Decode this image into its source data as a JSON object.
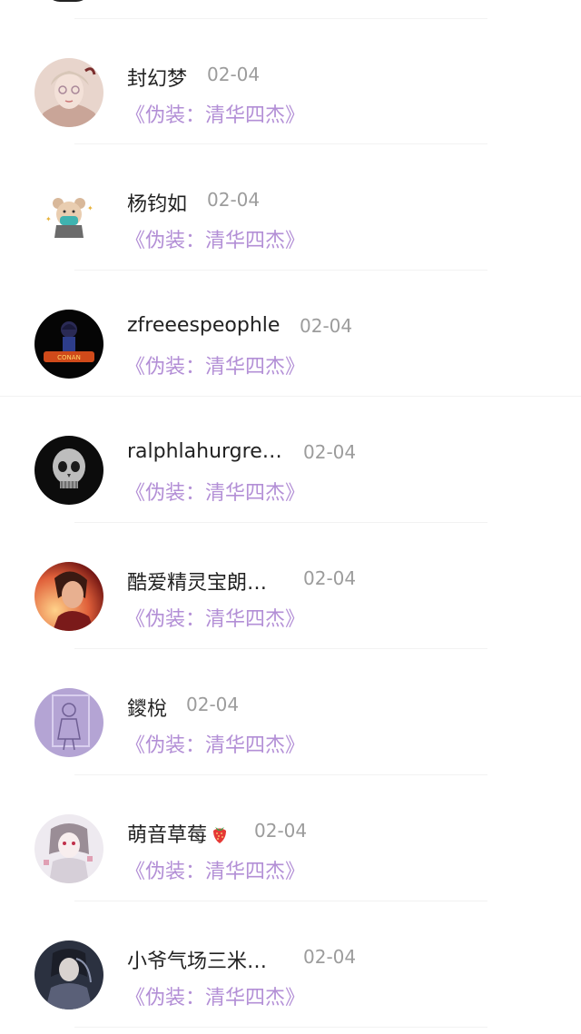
{
  "items": [
    {
      "name": "封幻梦",
      "date": "02-04",
      "subtitle": "《伪装：清华四杰》",
      "avatar_icon": "girl-portrait-avatar"
    },
    {
      "name": "杨钧如",
      "date": "02-04",
      "subtitle": "《伪装：清华四杰》",
      "avatar_icon": "bear-mask-avatar"
    },
    {
      "name": "zfreeespeophle",
      "date": "02-04",
      "subtitle": "《伪装：清华四杰》",
      "avatar_icon": "detective-logo-avatar"
    },
    {
      "name": "ralphlahurgre…",
      "date": "02-04",
      "subtitle": "《伪装：清华四杰》",
      "avatar_icon": "skull-avatar"
    },
    {
      "name": "酷爱精灵宝朗…",
      "date": "02-04",
      "subtitle": "《伪装：清华四杰》",
      "avatar_icon": "game-character-avatar"
    },
    {
      "name": "鑁梲",
      "date": "02-04",
      "subtitle": "《伪装：清华四杰》",
      "avatar_icon": "purple-sketch-avatar"
    },
    {
      "name": "萌音草莓",
      "date": "02-04",
      "subtitle": "《伪装：清华四杰》",
      "avatar_icon": "anime-girl-avatar",
      "name_emoji": "strawberry-icon"
    },
    {
      "name": "小爷气场三米…",
      "date": "02-04",
      "subtitle": "《伪装：清华四杰》",
      "avatar_icon": "dark-anime-avatar"
    }
  ],
  "colors": {
    "name": "#222222",
    "date": "#9c9c9c",
    "subtitle": "#b38fd6",
    "divider": "#f2f2f2"
  }
}
